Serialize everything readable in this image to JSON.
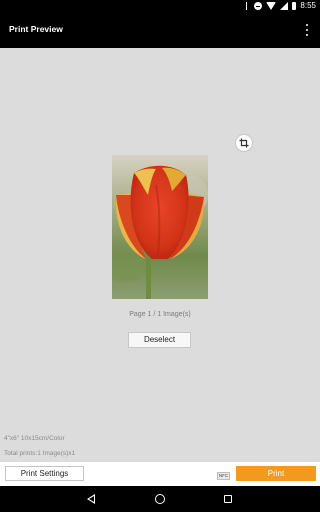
{
  "status_bar": {
    "time": "8:55",
    "icons": [
      "bluetooth-icon",
      "do-not-disturb-icon",
      "wifi-icon",
      "cellular-icon",
      "battery-icon"
    ]
  },
  "app_bar": {
    "title": "Print Preview",
    "menu_icon": "overflow-menu-icon"
  },
  "preview": {
    "crop_icon": "crop-icon",
    "image_subject": "red-yellow tulip photo",
    "page_info": "Page 1 / 1 Image(s)",
    "deselect_label": "Deselect"
  },
  "print_info": {
    "paper": "4\"x6\" 10x15cm/Color",
    "total": "Total prints:1 Image(s)x1"
  },
  "bottom_bar": {
    "settings_label": "Print Settings",
    "nfc_label": "NFC",
    "print_label": "Print",
    "accent_color": "#f29a1d"
  },
  "nav_bar": {
    "icons": [
      "back-icon",
      "home-icon",
      "recents-icon"
    ]
  }
}
